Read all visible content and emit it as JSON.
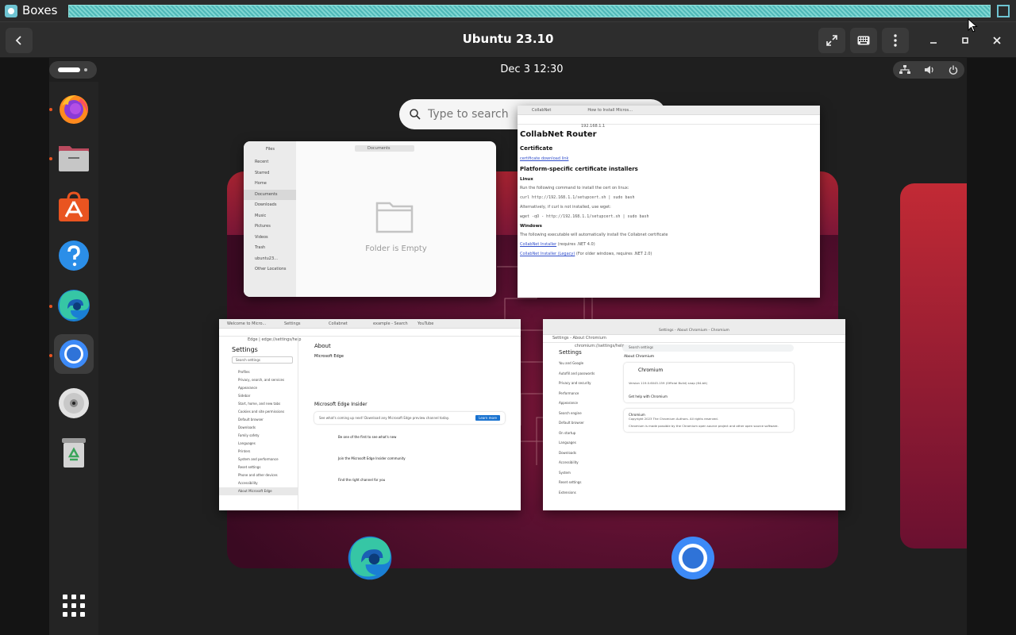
{
  "outer_window": {
    "app_name": "Boxes"
  },
  "header": {
    "back_icon": "chevron-left-icon",
    "title": "Ubuntu 23.10",
    "fullscreen_icon": "fullscreen-icon",
    "keyboard_icon": "keyboard-icon",
    "menu_icon": "vertical-dots-icon",
    "minimize_icon": "minimize-icon",
    "maximize_icon": "maximize-icon",
    "close_icon": "close-icon"
  },
  "topbar": {
    "clock": "Dec 3  12:30",
    "status_icons": [
      "network-icon",
      "volume-icon",
      "power-icon"
    ]
  },
  "dock": {
    "items": [
      {
        "name": "firefox",
        "running": true
      },
      {
        "name": "files",
        "running": true
      },
      {
        "name": "app-center",
        "running": false
      },
      {
        "name": "help",
        "running": false
      },
      {
        "name": "microsoft-edge",
        "running": true
      },
      {
        "name": "chromium",
        "running": true,
        "active": true
      },
      {
        "name": "disc",
        "running": false
      },
      {
        "name": "trash",
        "running": false
      }
    ],
    "apps_grid_icon": "app-grid-icon"
  },
  "search": {
    "placeholder": "Type to search"
  },
  "windows": {
    "files": {
      "title": "Files",
      "path": "Documents",
      "sidebar": [
        "Recent",
        "Starred",
        "Home",
        "Documents",
        "Downloads",
        "Music",
        "Pictures",
        "Videos",
        "Trash",
        "ubuntu23...",
        "Other Locations"
      ],
      "selected": "Documents",
      "empty_text": "Folder is Empty"
    },
    "firefox": {
      "tabs": [
        "CollabNet",
        "How to Install Micros..."
      ],
      "url": "192.168.1.1",
      "heading": "CollabNet Router",
      "certificate_heading": "Certificate",
      "certificate_link": "certificate download link",
      "platform_heading": "Platform-specific certificate installers",
      "linux_heading": "Linux",
      "linux_text": "Run the following command to install the cert on linux:",
      "linux_cmd": "curl http://192.168.1.1/setupcert.sh | sudo bash",
      "linux_alt": "Alternatively, if curl is not installed, use wget:",
      "linux_cmd2": "wget -qO - http://192.168.1.1/setupcert.sh | sudo bash",
      "windows_heading": "Windows",
      "windows_text": "The following executable will automatically install the Collabnet certificate",
      "win_link1": "CollabNet Installer",
      "win_link1_note": "(requires .NET 4.0)",
      "win_link2": "CollabNet Installer (Legacy)",
      "win_link2_note": "(For older windows, requires .NET 2.0)"
    },
    "edge": {
      "tabs": [
        "Welcome to Micro...",
        "Settings",
        "Collabnet",
        "example - Search",
        "YouTube"
      ],
      "url": "Edge | edge://settings/help",
      "settings_title": "Settings",
      "search_placeholder": "Search settings",
      "sidebar": [
        "Profiles",
        "Privacy, search, and services",
        "Appearance",
        "Sidebar",
        "Start, home, and new tabs",
        "Cookies and site permissions",
        "Default browser",
        "Downloads",
        "Family safety",
        "Languages",
        "Printers",
        "System and performance",
        "Reset settings",
        "Phone and other devices",
        "Accessibility",
        "About Microsoft Edge"
      ],
      "about_title": "About",
      "product": "Microsoft Edge",
      "insider_title": "Microsoft Edge Insider",
      "insider_text": "See what's coming up next! Download any Microsoft Edge preview channel today.",
      "learn_more": "Learn more",
      "item1": "Be one of the first to see what's new",
      "item2": "Join the Microsoft Edge Insider community",
      "item3": "Find the right channel for you"
    },
    "chromium": {
      "title": "Settings - About Chromium - Chromium",
      "tab": "Settings - About Chromium",
      "url": "chromium://settings/help",
      "settings_title": "Settings",
      "search_placeholder": "Search settings",
      "sidebar": [
        "You and Google",
        "Autofill and passwords",
        "Privacy and security",
        "Performance",
        "Appearance",
        "Search engine",
        "Default browser",
        "On startup",
        "Languages",
        "Downloads",
        "Accessibility",
        "System",
        "Reset settings",
        "Extensions"
      ],
      "about_heading": "About Chromium",
      "product": "Chromium",
      "version": "Version 119.0.6045.159 (Official Build) snap (64-bit)",
      "get_help": "Get help with Chromium",
      "copyright_name": "Chromium",
      "copyright": "Copyright 2023 The Chromium Authors. All rights reserved.",
      "opensource": "Chromium is made possible by the Chromium open source project and other open source software."
    }
  },
  "colors": {
    "ubuntu_orange": "#e95420",
    "workspace_red": "#8a1a3c",
    "dock_bg": "#242424"
  }
}
